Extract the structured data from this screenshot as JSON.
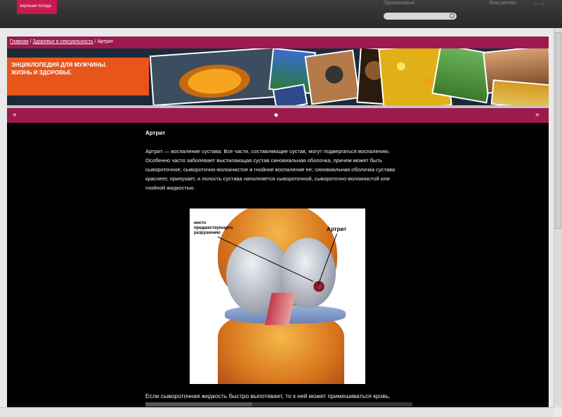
{
  "top": {
    "logo_text": "хорошая погода",
    "link_left": "Одноразовые",
    "link_right": "Ваш регион",
    "close_glyph": "×",
    "window_controls": "— ◇",
    "search_placeholder": ""
  },
  "breadcrumb": {
    "home": "Главная",
    "section": "Здоровье и сексуальность",
    "separator": "/",
    "current": "Артрит"
  },
  "banner": {
    "title_line1": "ЭНЦИКЛОПЕДИЯ ДЛЯ МУЖЧИНЫ.",
    "title_line2": "ЖИЗНЬ И ЗДОРОВЬЕ."
  },
  "nav": {
    "left_icon": "double-chevron-left-icon",
    "center_icon": "diamond-icon",
    "right_icon": "double-chevron-right-icon",
    "left_glyph": "«",
    "center_glyph": "◆",
    "right_glyph": "»"
  },
  "article": {
    "title": "Артрит",
    "body": "Артрит — воспаление сустава. Все части, составляющие сустав, могут подвергаться воспалению. Особенно часто заболевает выстилающая сустав синовиальная оболочка, причем может быть сывороточное, сывороточно-волокнистое и гнойное воспаление ее; синовиальная оболочка сустава краснеет, припухает, и полость сустава наполняется сывороточной, сывороточно-волокнистой или гнойной жидкостью.",
    "figure": {
      "label_left_1": "место",
      "label_left_2": "предшествующего",
      "label_left_3": "разрушению",
      "label_right": "Артрит"
    },
    "bottom_text": "Если сывороточная жидкость быстро выпотевает, то к ней может примешиваться кровь."
  }
}
